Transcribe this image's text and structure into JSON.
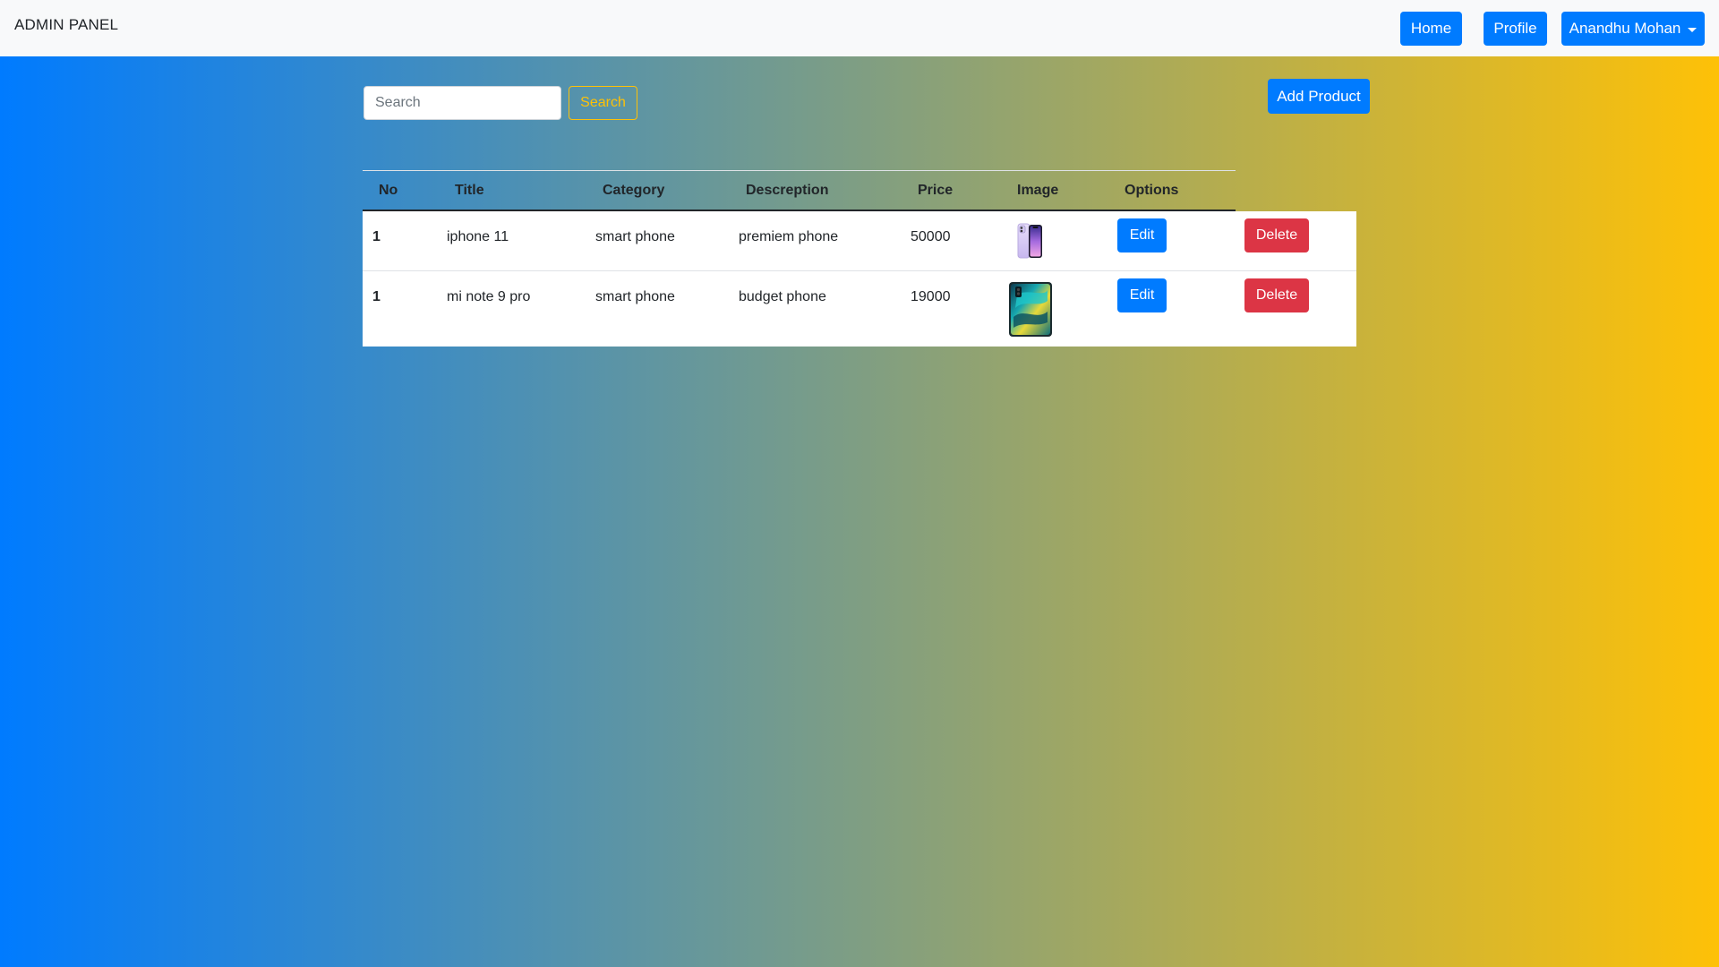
{
  "navbar": {
    "brand": "ADMIN PANEL",
    "home": "Home",
    "profile": "Profile",
    "user": "Anandhu Mohan"
  },
  "search": {
    "placeholder": "Search",
    "value": "",
    "button": "Search"
  },
  "add_product": "Add Product",
  "table": {
    "headers": [
      "No",
      "Title",
      "Category",
      "Descreption",
      "Price",
      "Image",
      "Options"
    ],
    "rows": [
      {
        "no": "1",
        "title": "iphone 11",
        "category": "smart phone",
        "description": "premiem phone",
        "price": "50000",
        "image": "iphone-11-purple-image",
        "edit": "Edit",
        "delete": "Delete"
      },
      {
        "no": "1",
        "title": "mi note 9 pro",
        "category": "smart phone",
        "description": "budget phone",
        "price": "19000",
        "image": "mi-note-9-pro-teal-image",
        "edit": "Edit",
        "delete": "Delete"
      }
    ]
  },
  "colors": {
    "gradient_start": "#007bff",
    "gradient_end": "#fec107",
    "primary": "#007bff",
    "danger": "#dc3545",
    "warning": "#fec107"
  }
}
